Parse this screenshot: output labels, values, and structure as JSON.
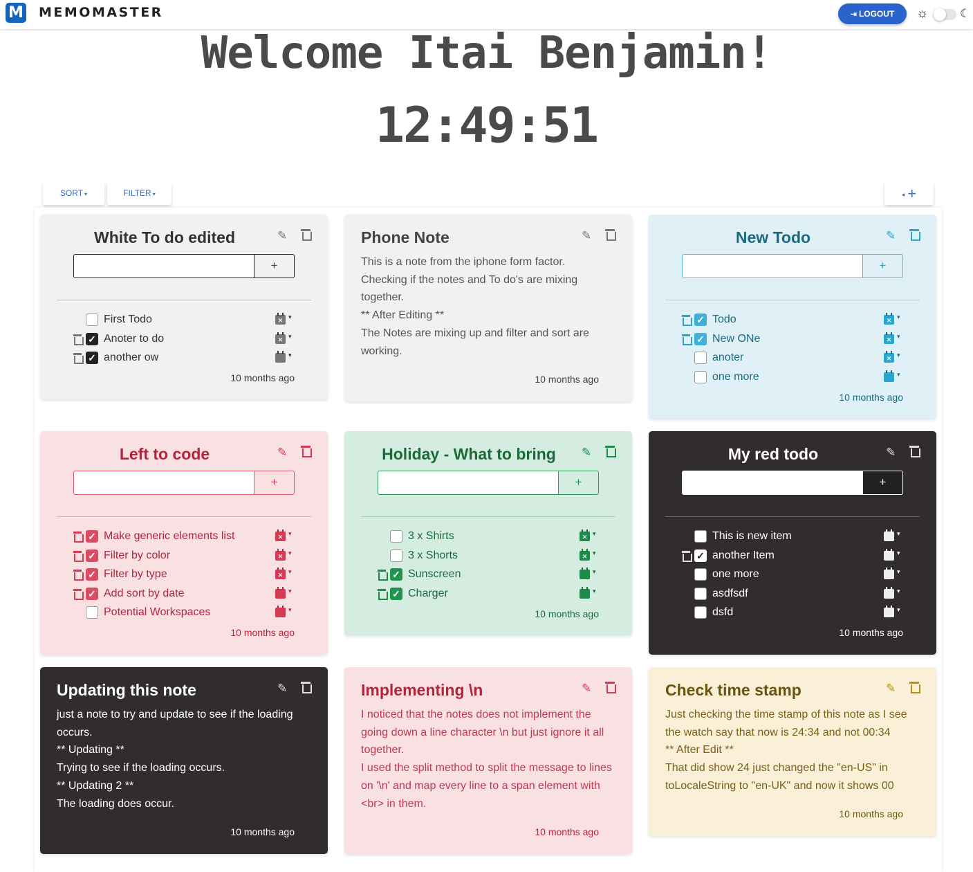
{
  "app": {
    "logo_letter": "M",
    "brand": "MEMOMASTER",
    "logout": "LOGOUT"
  },
  "hero": {
    "welcome": "Welcome Itai Benjamin!",
    "clock": "12:49:51"
  },
  "toolbar": {
    "sort": "SORT",
    "filter": "FILTER",
    "add": "+"
  },
  "colors": {
    "accent": "#2a63c9",
    "gray": "#f1f1f1",
    "blue": "#dff0f6",
    "pink": "#f9e0e3",
    "green": "#d4ede0",
    "dark": "#302d2c",
    "yellow": "#faf0d8"
  },
  "cards": {
    "c1": {
      "title": "White To do edited",
      "add": "+",
      "time": "10 months ago",
      "items": [
        {
          "label": "First Todo",
          "checked": false
        },
        {
          "label": "Anoter to do",
          "checked": true
        },
        {
          "label": "another ow",
          "checked": true
        }
      ]
    },
    "c2": {
      "title": "Phone Note",
      "time": "10 months ago",
      "lines": [
        "This is a note from the iphone form factor.",
        "Checking if the notes and To do's are mixing",
        "together.",
        "** After Editing **",
        "The Notes are mixing up and filter and sort are",
        "working."
      ]
    },
    "c3": {
      "title": "New Todo",
      "add": "+",
      "time": "10 months ago",
      "items": [
        {
          "label": "Todo",
          "checked": true
        },
        {
          "label": "New ONe",
          "checked": true
        },
        {
          "label": "anoter",
          "checked": false
        },
        {
          "label": "one more",
          "checked": false
        }
      ]
    },
    "c4": {
      "title": "Left to code",
      "add": "+",
      "time": "10 months ago",
      "items": [
        {
          "label": "Make generic elements list",
          "checked": true
        },
        {
          "label": "Filter by color",
          "checked": true
        },
        {
          "label": "Filter by type",
          "checked": true
        },
        {
          "label": "Add sort by date",
          "checked": true
        },
        {
          "label": "Potential Workspaces",
          "checked": false
        }
      ]
    },
    "c5": {
      "title": "Holiday - What to bring",
      "add": "+",
      "time": "10 months ago",
      "items": [
        {
          "label": "3 x Shirts",
          "checked": false
        },
        {
          "label": "3 x Shorts",
          "checked": false
        },
        {
          "label": "Sunscreen",
          "checked": true
        },
        {
          "label": "Charger",
          "checked": true
        }
      ]
    },
    "c6": {
      "title": "My red todo",
      "add": "+",
      "time": "10 months ago",
      "items": [
        {
          "label": "This is new item",
          "checked": false
        },
        {
          "label": "another Item",
          "checked": true
        },
        {
          "label": "one more",
          "checked": false
        },
        {
          "label": "asdfsdf",
          "checked": false
        },
        {
          "label": "dsfd",
          "checked": false
        }
      ]
    },
    "c7": {
      "title": "Updating this note",
      "time": "10 months ago",
      "lines": [
        "just a note to try and update to see if the loading",
        "occurs.",
        "** Updating **",
        "Trying to see if the loading occurs.",
        "** Updating 2 **",
        "The loading does occur."
      ]
    },
    "c8": {
      "title": "Implementing \\n",
      "time": "10 months ago",
      "lines": [
        "I noticed that the notes does not implement the",
        "going down a line character \\n but just ignore it all",
        "together.",
        "I used the split method to split the message to lines",
        "on '\\n' and map every line to a span element with",
        "<br> in them."
      ]
    },
    "c9": {
      "title": "Check time stamp",
      "time": "10 months ago",
      "lines": [
        "Just checking the time stamp of this note as I see",
        "the watch say that now is 24:34 and not 00:34",
        "** After Edit **",
        "That did show 24 just changed the \"en-US\" in",
        "toLocaleString to \"en-UK\" and now it shows 00"
      ]
    }
  }
}
